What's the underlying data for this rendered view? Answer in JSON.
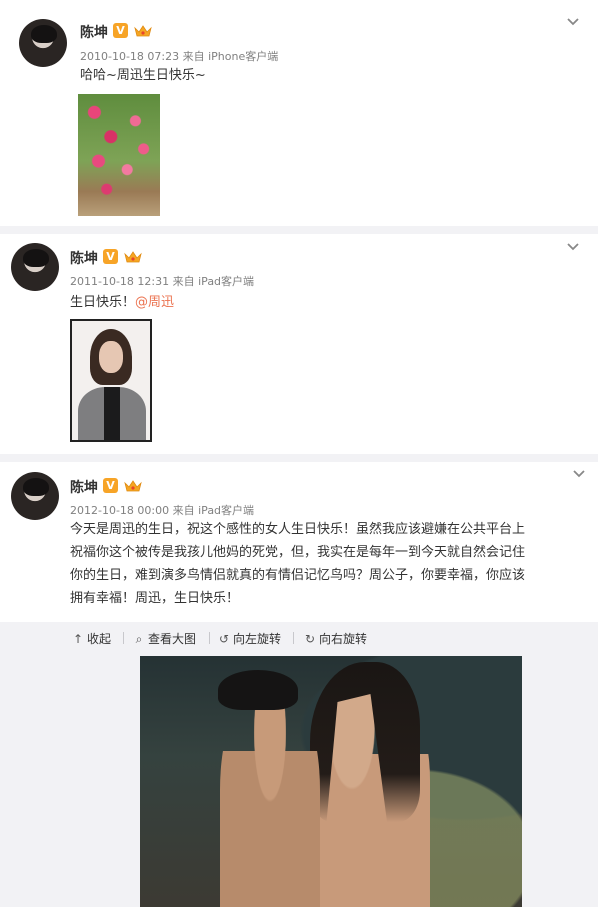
{
  "posts": [
    {
      "author": "陈坤",
      "verified_badge": "V",
      "time": "2010-10-18 07:23",
      "source": "来自 iPhone客户端",
      "text": "哈哈~周迅生日快乐~",
      "image_icon": "roses-photo"
    },
    {
      "author": "陈坤",
      "verified_badge": "V",
      "time": "2011-10-18 12:31",
      "source": "来自 iPad客户端",
      "text": "生日快乐！",
      "mention": "@周迅",
      "image_icon": "portrait-photo"
    },
    {
      "author": "陈坤",
      "verified_badge": "V",
      "time": "2012-10-18 00:00",
      "source": "来自 iPad客户端",
      "text_lines": [
        "今天是周迅的生日，祝这个感性的女人生日快乐！虽然我应该避嫌在公共平台上",
        "祝福你这个被传是我孩儿他妈的死党，但，我实在是每年一到今天就自然会记住",
        "你的生日，难到演多鸟情侣就真的有情侣记忆鸟吗？周公子，你要幸福，你应该",
        "拥有幸福！周迅，生日快乐！"
      ],
      "image_icon": "couple-photo"
    }
  ],
  "toolbar": {
    "collapse_label": "收起",
    "view_large_label": "查看大图",
    "rotate_left_label": "向左旋转",
    "rotate_right_label": "向右旋转"
  },
  "colors": {
    "mention": "#eb7350",
    "verified_badge": "#f7a427",
    "toolbar_bg": "#f2f2f5"
  }
}
